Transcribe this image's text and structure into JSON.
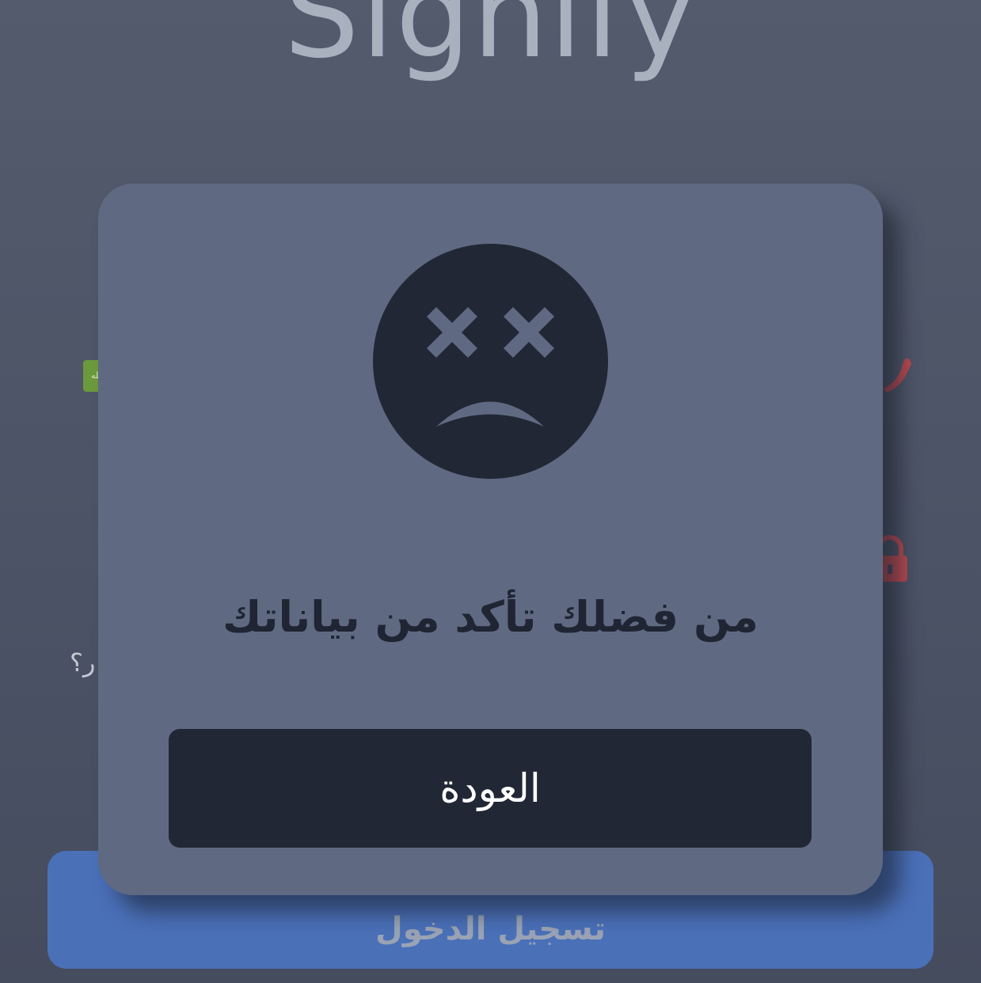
{
  "app": {
    "logo_text": "Signify"
  },
  "login": {
    "country_flag_text": "الله",
    "forgot_password_fragment": "ر؟",
    "login_button_label": "تسجيل الدخول",
    "phone_icon": "phone-icon",
    "lock_icon": "lock-icon"
  },
  "dialog": {
    "icon": "sad-face-icon",
    "message": "من فضلك تأكد من بياناتك",
    "back_button_label": "العودة"
  },
  "colors": {
    "background": "#4c5366",
    "modal": "#5f6a82",
    "dark": "#212735",
    "primary_button": "#4a70b8",
    "icon_red": "#b94a52",
    "flag_green": "#6b9a3c"
  }
}
